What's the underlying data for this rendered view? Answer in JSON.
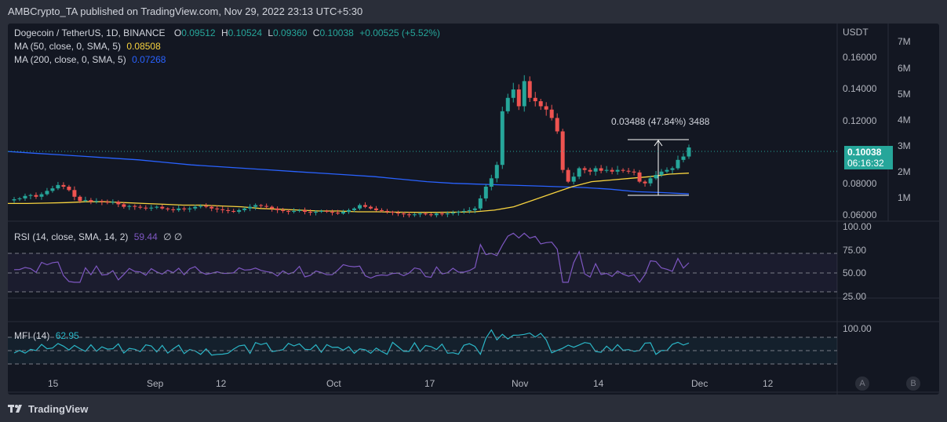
{
  "header": {
    "publisher": "AMBCrypto_TA published on TradingView.com, Nov 29, 2022 23:13 UTC+5:30"
  },
  "symbol": {
    "title": "Dogecoin / TetherUS, 1D, BINANCE",
    "o_label": "O",
    "o": "0.09512",
    "h_label": "H",
    "h": "0.10524",
    "l_label": "L",
    "l": "0.09360",
    "c_label": "C",
    "c": "0.10038",
    "change": "+0.00525 (+5.52%)"
  },
  "indicators": {
    "ma50_label": "MA (50, close, 0, SMA, 5)",
    "ma50_value": "0.08508",
    "ma50_color": "#f7d33f",
    "ma200_label": "MA (200, close, 0, SMA, 5)",
    "ma200_value": "0.07268",
    "ma200_color": "#2962ff",
    "rsi_label": "RSI (14, close, SMA, 14, 2)",
    "rsi_value": "59.44",
    "rsi_extra": "∅ ∅",
    "mfi_label": "MFI (14)",
    "mfi_value": "62.95"
  },
  "price_axis": {
    "currency": "USDT",
    "ticks": [
      "0.16000",
      "0.14000",
      "0.12000",
      "0.08000",
      "0.06000"
    ],
    "last_price": "0.10038",
    "countdown": "06:16:32"
  },
  "volume_axis": {
    "ticks": [
      "7M",
      "6M",
      "5M",
      "4M",
      "3M",
      "2M",
      "1M"
    ]
  },
  "rsi_axis": {
    "ticks": [
      "100.00",
      "75.00",
      "50.00",
      "25.00"
    ]
  },
  "mfi_axis": {
    "ticks": [
      "100.00"
    ]
  },
  "time_axis": {
    "ticks": [
      "15",
      "Sep",
      "12",
      "Oct",
      "17",
      "Nov",
      "14",
      "Dec",
      "12"
    ]
  },
  "measure": {
    "label": "0.03488 (47.84%) 3488"
  },
  "scale_buttons": {
    "auto": "A",
    "log": "B"
  },
  "footer": {
    "brand": "TradingView"
  },
  "colors": {
    "up": "#26a69a",
    "down": "#ef5350",
    "rsi": "#7e57c2",
    "mfi": "#2bb7c8",
    "background": "#131722"
  },
  "chart_data": {
    "type": "candlestick",
    "symbol": "Dogecoin / TetherUS",
    "interval": "1D",
    "price_range": [
      0.055,
      0.165
    ],
    "last_close": 0.10038,
    "close_series_approx": [
      0.0695,
      0.07,
      0.0715,
      0.072,
      0.071,
      0.0725,
      0.0745,
      0.076,
      0.078,
      0.077,
      0.075,
      0.071,
      0.0685,
      0.069,
      0.068,
      0.0685,
      0.068,
      0.0675,
      0.068,
      0.0665,
      0.065,
      0.0655,
      0.065,
      0.0645,
      0.064,
      0.0645,
      0.065,
      0.064,
      0.0635,
      0.063,
      0.064,
      0.0635,
      0.064,
      0.065,
      0.0655,
      0.065,
      0.064,
      0.0635,
      0.063,
      0.0625,
      0.062,
      0.063,
      0.064,
      0.065,
      0.066,
      0.0655,
      0.065,
      0.064,
      0.063,
      0.0625,
      0.062,
      0.0625,
      0.063,
      0.062,
      0.0615,
      0.062,
      0.0625,
      0.062,
      0.0615,
      0.061,
      0.062,
      0.063,
      0.064,
      0.066,
      0.065,
      0.064,
      0.063,
      0.0625,
      0.062,
      0.0615,
      0.061,
      0.0605,
      0.06,
      0.0605,
      0.061,
      0.0605,
      0.06,
      0.061,
      0.0605,
      0.061,
      0.0615,
      0.062,
      0.0625,
      0.063,
      0.064,
      0.07,
      0.077,
      0.082,
      0.09,
      0.122,
      0.13,
      0.135,
      0.125,
      0.14,
      0.13,
      0.128,
      0.125,
      0.123,
      0.118,
      0.11,
      0.087,
      0.08,
      0.083,
      0.088,
      0.087,
      0.086,
      0.088,
      0.0865,
      0.087,
      0.086,
      0.087,
      0.0865,
      0.086,
      0.0855,
      0.08,
      0.079,
      0.082,
      0.084,
      0.086,
      0.087,
      0.088,
      0.093,
      0.095,
      0.1004
    ],
    "ma50_approx": [
      0.067,
      0.067,
      0.0672,
      0.0675,
      0.068,
      0.068,
      0.0675,
      0.067,
      0.0665,
      0.066,
      0.066,
      0.0655,
      0.065,
      0.064,
      0.0635,
      0.063,
      0.0625,
      0.0625,
      0.062,
      0.062,
      0.0618,
      0.0617,
      0.0617,
      0.0618,
      0.062,
      0.063,
      0.065,
      0.069,
      0.073,
      0.077,
      0.08,
      0.081,
      0.082,
      0.083,
      0.0845,
      0.0851
    ],
    "ma200_approx": [
      0.098,
      0.097,
      0.096,
      0.095,
      0.094,
      0.093,
      0.0915,
      0.09,
      0.089,
      0.088,
      0.087,
      0.086,
      0.085,
      0.084,
      0.083,
      0.0815,
      0.08,
      0.079,
      0.0785,
      0.078,
      0.0775,
      0.077,
      0.0765,
      0.0755,
      0.074,
      0.0735,
      0.0727
    ],
    "rsi_range": [
      25,
      100
    ],
    "rsi_last": 59.44,
    "mfi_last": 62.95
  }
}
